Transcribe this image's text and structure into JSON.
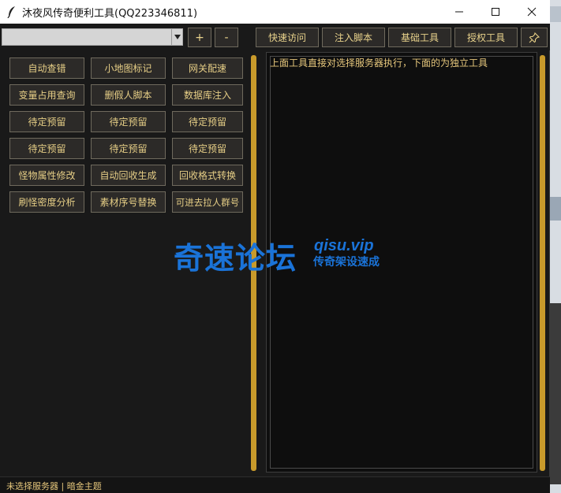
{
  "window": {
    "title": "沐夜风传奇便利工具(QQ223346811)"
  },
  "toolbar": {
    "server_select_value": "",
    "add_label": "+",
    "remove_label": "-",
    "tabs": [
      {
        "label": "快速访问"
      },
      {
        "label": "注入脚本"
      },
      {
        "label": "基础工具"
      },
      {
        "label": "授权工具"
      }
    ],
    "pin_icon": "pin-icon"
  },
  "tools": [
    [
      "自动查错",
      "小地图标记",
      "网关配速"
    ],
    [
      "变量占用查询",
      "删假人脚本",
      "数据库注入"
    ],
    [
      "待定预留",
      "待定预留",
      "待定预留"
    ],
    [
      "待定预留",
      "待定预留",
      "待定预留"
    ],
    [
      "怪物属性修改",
      "自动回收生成",
      "回收格式转换"
    ],
    [
      "刷怪密度分析",
      "素材序号替换",
      "可进去拉人群号"
    ]
  ],
  "output": {
    "text": "上面工具直接对选择服务器执行，下面的为独立工具"
  },
  "watermark": {
    "main": "奇速论坛",
    "url": "qisu.vip",
    "sub": "传奇架设速成"
  },
  "status": {
    "text": "未选择服务器 | 暗金主题"
  },
  "colors": {
    "accent_gold": "#e6ce86",
    "rail_gold": "#c89a2b",
    "background": "#191919",
    "watermark_blue": "#1a73d8"
  }
}
